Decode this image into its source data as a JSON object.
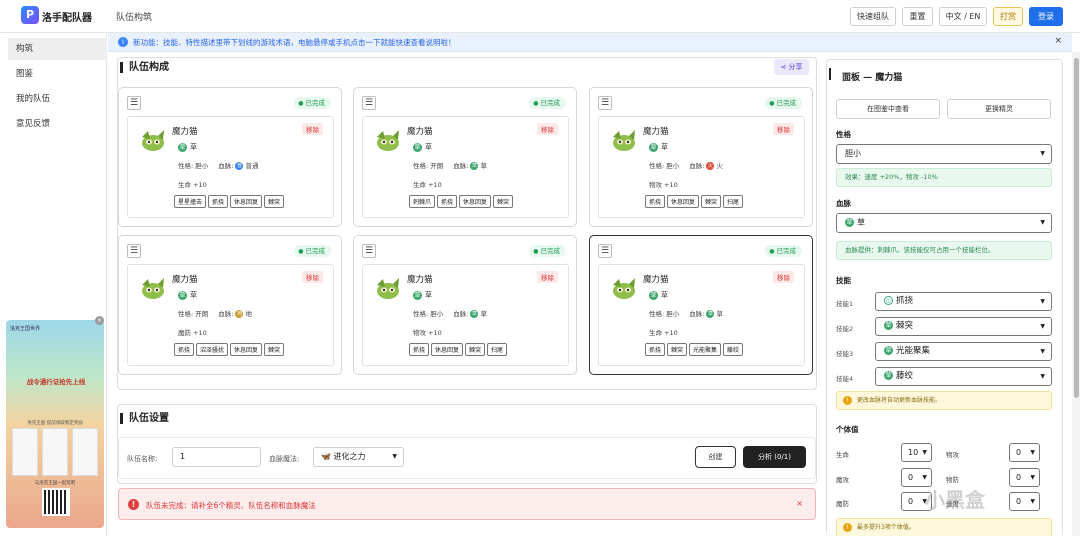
{
  "app": {
    "logo_letter": "P",
    "name": "洛手配队器",
    "page_title": "队伍构筑"
  },
  "topbar": {
    "quick": "快速组队",
    "reset": "重置",
    "lang": "中文 / EN",
    "tip": "打赏",
    "login": "登录"
  },
  "sidebar": {
    "items": [
      "构筑",
      "图鉴",
      "我的队伍",
      "意见反馈"
    ]
  },
  "banner": {
    "text": "新功能：技能、特性描述里带下划线的游戏术语，电脑悬停或手机点击一下就能快速查看说明啦！",
    "close": "×"
  },
  "team": {
    "title": "队伍构成",
    "share": "分享",
    "cards": [
      {
        "name": "魔力猫",
        "type": "草",
        "personality": "性格: 胆小",
        "blood": "血脉:",
        "blood_icon": "普",
        "blood_name": "普通",
        "stat": "生命 +10",
        "skills": [
          "星星撞击",
          "抓挠",
          "休息回复",
          "棘突"
        ],
        "status": "已完成",
        "remove": "移除"
      },
      {
        "name": "魔力猫",
        "type": "草",
        "personality": "性格: 开朗",
        "blood": "血脉:",
        "blood_icon": "草",
        "blood_name": "草",
        "stat": "生命 +10",
        "skills": [
          "刺棘爪",
          "抓挠",
          "休息回复",
          "棘突"
        ],
        "status": "已完成",
        "remove": "移除"
      },
      {
        "name": "魔力猫",
        "type": "草",
        "personality": "性格: 胆小",
        "blood": "血脉:",
        "blood_icon": "火",
        "blood_name": "火",
        "stat": "物攻 +10",
        "skills": [
          "抓挠",
          "休息回复",
          "棘突",
          "扫尾"
        ],
        "status": "已完成",
        "remove": "移除"
      },
      {
        "name": "魔力猫",
        "type": "草",
        "personality": "性格: 开朗",
        "blood": "血脉:",
        "blood_icon": "地",
        "blood_name": "地",
        "stat": "魔防 +10",
        "skills": [
          "抓挠",
          "沼泽骚扰",
          "休息回复",
          "棘突"
        ],
        "status": "已完成",
        "remove": "移除"
      },
      {
        "name": "魔力猫",
        "type": "草",
        "personality": "性格: 胆小",
        "blood": "血脉:",
        "blood_icon": "草",
        "blood_name": "草",
        "stat": "物攻 +10",
        "skills": [
          "抓挠",
          "休息回复",
          "棘突",
          "扫尾"
        ],
        "status": "已完成",
        "remove": "移除"
      },
      {
        "name": "魔力猫",
        "type": "草",
        "personality": "性格: 胆小",
        "blood": "血脉:",
        "blood_icon": "草",
        "blood_name": "草",
        "stat": "生命 +10",
        "skills": [
          "抓挠",
          "棘突",
          "光能聚集",
          "藤绞"
        ],
        "status": "已完成",
        "remove": "移除"
      }
    ]
  },
  "settings": {
    "title": "队伍设置",
    "name_label": "队伍名称:",
    "name_value": "1",
    "magic_label": "血脉魔法:",
    "magic_icon": "🦋",
    "magic_value": "进化之力",
    "create": "创建",
    "analyze": "分析 (0/1)"
  },
  "error": {
    "icon": "!",
    "text": "队伍未完成：请补全6个精灵、队伍名称和血脉魔法",
    "close": "×"
  },
  "ad": {
    "close": "×",
    "head": "洛克王国世界",
    "title": "战令通行证抢先上线",
    "sub": "洛克王国 提前领取限定奖励",
    "foot": "与洛克王国一起玩吧"
  },
  "right": {
    "title": "面板 — 魔力猫",
    "view_btn": "在图鉴中查看",
    "swap_btn": "更换精灵",
    "personality_label": "性格",
    "personality_value": "胆小",
    "personality_effect": "效果：速度 +20%，物攻 -10%",
    "blood_label": "血脉",
    "blood_value": "草",
    "blood_note": "血脉提供：刺棘爪。该技能仅可占用一个技能栏位。",
    "skills_label": "技能",
    "skill_rows": [
      {
        "label": "技能1",
        "value": "抓挠",
        "icon": "⊙"
      },
      {
        "label": "技能2",
        "value": "棘突",
        "icon": "草"
      },
      {
        "label": "技能3",
        "value": "光能聚集",
        "icon": "草"
      },
      {
        "label": "技能4",
        "value": "藤绞",
        "icon": "草"
      }
    ],
    "skill_warn": "更改血脉将自动更新血脉技能。",
    "iv_label": "个体值",
    "ivs": [
      {
        "label": "生命",
        "value": "10"
      },
      {
        "label": "物攻",
        "value": "0"
      },
      {
        "label": "魔攻",
        "value": "0"
      },
      {
        "label": "物防",
        "value": "0"
      },
      {
        "label": "魔防",
        "value": "0"
      },
      {
        "label": "速度",
        "value": "0"
      }
    ],
    "iv_warn": "最多提升3项个体值。"
  },
  "watermark": "小黑盒",
  "colors": {
    "accent": "#1f6feb",
    "success": "#1f9d55",
    "danger": "#e23d3d",
    "grass": "#3aa56b"
  }
}
